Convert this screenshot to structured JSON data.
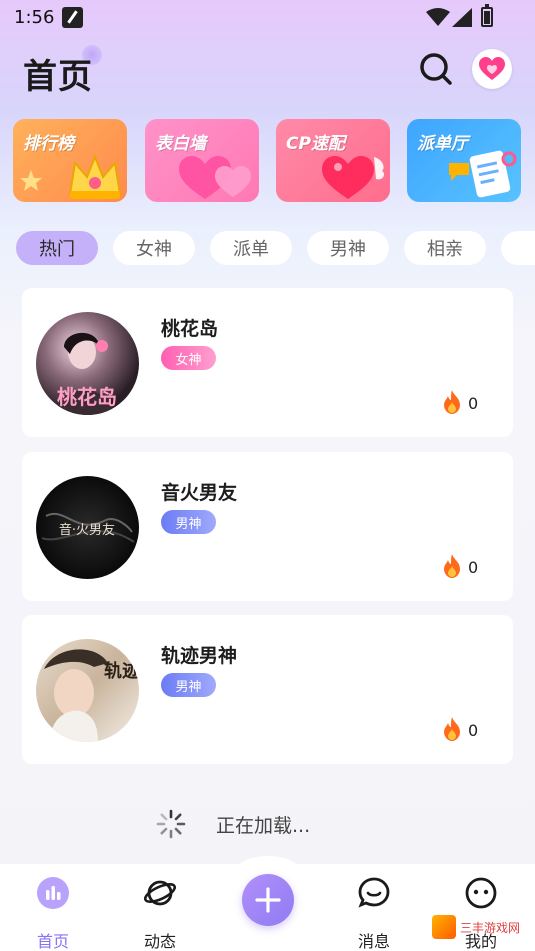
{
  "status_bar": {
    "time": "1:56"
  },
  "header": {
    "title": "首页"
  },
  "banners": [
    {
      "label": "排行榜"
    },
    {
      "label": "表白墙"
    },
    {
      "label": "CP速配"
    },
    {
      "label": "派单厅"
    }
  ],
  "tabs": [
    {
      "label": "热门",
      "active": true
    },
    {
      "label": "女神"
    },
    {
      "label": "派单"
    },
    {
      "label": "男神"
    },
    {
      "label": "相亲"
    },
    {
      "label": ""
    }
  ],
  "rooms": [
    {
      "title": "桃花岛",
      "badge": "女神",
      "count": "0",
      "avatar_text": "桃花岛"
    },
    {
      "title": "音火男友",
      "badge": "男神",
      "count": "0",
      "avatar_text": "音·火男友"
    },
    {
      "title": "轨迹男神",
      "badge": "男神",
      "count": "0",
      "avatar_text": "轨迹"
    }
  ],
  "loading": {
    "text": "正在加载..."
  },
  "bottom_nav": [
    {
      "label": "首页",
      "active": true
    },
    {
      "label": "动态"
    },
    {
      "label": ""
    },
    {
      "label": "消息"
    },
    {
      "label": "我的"
    }
  ],
  "watermark": {
    "text": "三丰游戏网"
  },
  "colors": {
    "accent": "#8b72f0",
    "tab_active": "#c4b1f9",
    "female_badge": "#ff5fb0",
    "male_badge": "#6b7cf5",
    "fire": "#ff6a1a"
  }
}
